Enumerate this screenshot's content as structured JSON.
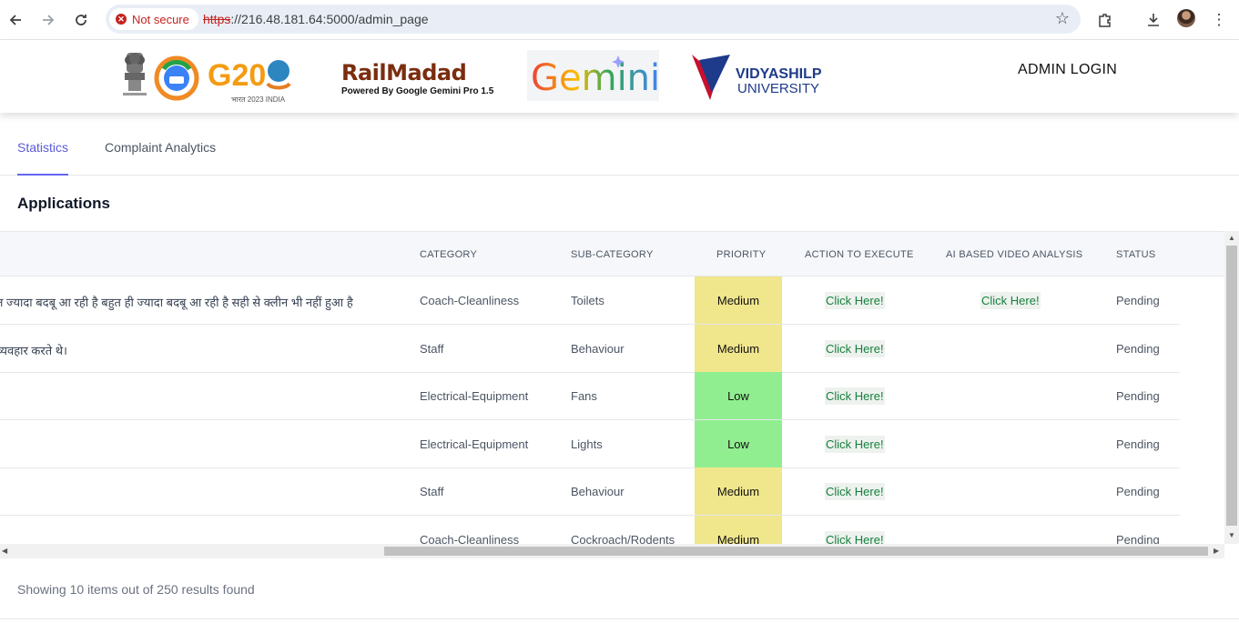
{
  "browser": {
    "security_label": "Not secure",
    "url_protocol": "https",
    "url_rest": "://216.48.181.64:5000/admin_page"
  },
  "header": {
    "g20_text": "G20",
    "g20_sub": "भारत 2023 INDIA",
    "railmadad_title": "RailMadad",
    "railmadad_sub": "Powered By Google Gemini Pro 1.5",
    "gemini_text": "Gemini",
    "university_name_1": "VIDYASHILP",
    "university_name_2": "UNIVERSITY",
    "admin_login": "ADMIN LOGIN"
  },
  "tabs": [
    {
      "label": "Statistics",
      "active": true
    },
    {
      "label": "Complaint Analytics",
      "active": false
    }
  ],
  "section_title": "Applications",
  "table": {
    "columns": [
      "CATEGORY",
      "SUB-CATEGORY",
      "PRIORITY",
      "ACTION TO EXECUTE",
      "AI BASED VIDEO ANALYSIS",
      "STATUS"
    ],
    "rows": [
      {
        "description": "त ज्यादा बदबू आ रही है बहुत ही ज्यादा बदबू आ रही है सही से क्लीन भी नहीं हुआ है",
        "category": "Coach-Cleanliness",
        "sub_category": "Toilets",
        "priority": "Medium",
        "action": "Click Here!",
        "video": "Click Here!",
        "status": "Pending"
      },
      {
        "description": "व्यवहार करते थे।",
        "category": "Staff",
        "sub_category": "Behaviour",
        "priority": "Medium",
        "action": "Click Here!",
        "video": "",
        "status": "Pending"
      },
      {
        "description": "",
        "category": "Electrical-Equipment",
        "sub_category": "Fans",
        "priority": "Low",
        "action": "Click Here!",
        "video": "",
        "status": "Pending"
      },
      {
        "description": "",
        "category": "Electrical-Equipment",
        "sub_category": "Lights",
        "priority": "Low",
        "action": "Click Here!",
        "video": "",
        "status": "Pending"
      },
      {
        "description": "",
        "category": "Staff",
        "sub_category": "Behaviour",
        "priority": "Medium",
        "action": "Click Here!",
        "video": "",
        "status": "Pending"
      },
      {
        "description": "",
        "category": "Coach-Cleanliness",
        "sub_category": "Cockroach/Rodents",
        "priority": "Medium",
        "action": "Click Here!",
        "video": "",
        "status": "Pending"
      }
    ]
  },
  "footer": {
    "summary": "Showing 10 items out of 250 results found"
  },
  "colors": {
    "priority_medium": "#f0e68c",
    "priority_low": "#90ee90",
    "tab_active": "#5b5bd6",
    "link_green": "#15803d"
  }
}
